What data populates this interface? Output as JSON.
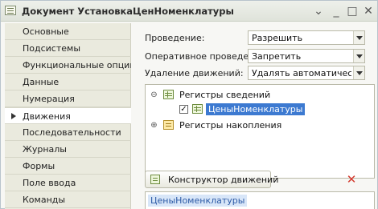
{
  "window": {
    "title": "Документ УстановкаЦенНоменклатуры",
    "buttons": {
      "more": "⌄",
      "minimize": "_",
      "maximize": "□",
      "close": "✕"
    }
  },
  "sidebar": {
    "items": [
      {
        "label": "Основные",
        "active": false
      },
      {
        "label": "Подсистемы",
        "active": false
      },
      {
        "label": "Функциональные опции",
        "active": false
      },
      {
        "label": "Данные",
        "active": false
      },
      {
        "label": "Нумерация",
        "active": false
      },
      {
        "label": "Движения",
        "active": true
      },
      {
        "label": "Последовательности",
        "active": false
      },
      {
        "label": "Журналы",
        "active": false
      },
      {
        "label": "Формы",
        "active": false
      },
      {
        "label": "Поле ввода",
        "active": false
      },
      {
        "label": "Команды",
        "active": false
      }
    ]
  },
  "form": {
    "posting": {
      "label": "Проведение:",
      "value": "Разрешить"
    },
    "realtime_posting": {
      "label": "Оперативное проведение:",
      "value": "Запретить"
    },
    "movement_deletion": {
      "label": "Удаление движений:",
      "value": "Удалять автоматически п"
    }
  },
  "tree": {
    "info_registers": {
      "expander": "⊖",
      "label": "Регистры сведений",
      "icon": "info-register-icon"
    },
    "selected_register": {
      "label": "ЦеныНоменклатуры",
      "checked": true,
      "check_glyph": "✓"
    },
    "accumulation_registers": {
      "expander": "⊕",
      "label": "Регистры накопления",
      "icon": "accumulation-register-icon"
    }
  },
  "toolbar": {
    "constructor_label": "Конструктор движений",
    "delete_glyph": "✕"
  },
  "movements_list": {
    "items": [
      "ЦеныНоменклатуры"
    ]
  },
  "colors": {
    "selection": "#3d7ad1",
    "delete": "#d33b2f",
    "accent_green": "#6d8c3e"
  }
}
